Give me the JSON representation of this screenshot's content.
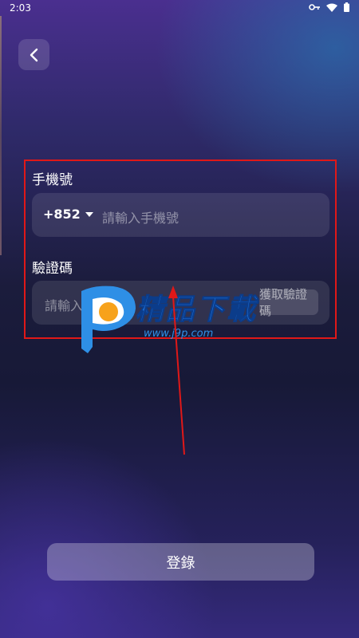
{
  "status_bar": {
    "time": "2:03",
    "icons": [
      "key-icon",
      "wifi-icon",
      "battery-icon"
    ]
  },
  "header": {
    "back_icon": "chevron-left-icon"
  },
  "form": {
    "phone_label": "手機號",
    "country_code": "+852",
    "phone_placeholder": "請輸入手機號",
    "code_label": "驗證碼",
    "code_placeholder": "請輸入驗證碼",
    "send_code_label": "獲取驗證碼"
  },
  "login_button": {
    "label": "登錄"
  },
  "watermark": {
    "brand": "精品下載",
    "url": "www.j9p.com"
  },
  "colors": {
    "annotation_red": "#e01818",
    "watermark_blue": "#1e6fd8",
    "watermark_orange": "#f7a21b"
  }
}
